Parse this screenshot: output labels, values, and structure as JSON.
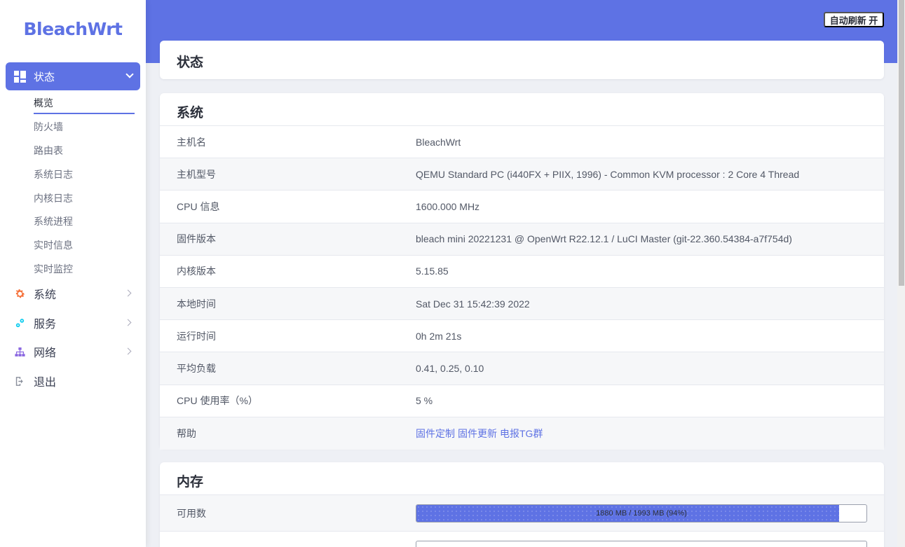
{
  "brand": "BleachWrt",
  "sidebar": {
    "active_menu": "状态",
    "sub_items": [
      "概览",
      "防火墙",
      "路由表",
      "系统日志",
      "内核日志",
      "系统进程",
      "实时信息",
      "实时监控"
    ],
    "menus": [
      {
        "label": "系统",
        "icon": "gear-icon",
        "color": "#f5713a"
      },
      {
        "label": "服务",
        "icon": "puzzle-icon",
        "color": "#11cdef"
      },
      {
        "label": "网络",
        "icon": "network-icon",
        "color": "#8965e0"
      },
      {
        "label": "退出",
        "icon": "logout-icon",
        "color": "#8a8f9c"
      }
    ]
  },
  "header": {
    "refresh_label": "自动刷新 开"
  },
  "page": {
    "title": "状态"
  },
  "system": {
    "title": "系统",
    "rows": [
      {
        "key": "主机名",
        "value": "BleachWrt"
      },
      {
        "key": "主机型号",
        "value": "QEMU Standard PC (i440FX + PIIX, 1996) - Common KVM processor : 2 Core 4 Thread"
      },
      {
        "key": "CPU 信息",
        "value": "1600.000 MHz"
      },
      {
        "key": "固件版本",
        "value": "bleach mini 20221231 @ OpenWrt R22.12.1 / LuCI Master (git-22.360.54384-a7f754d)"
      },
      {
        "key": "内核版本",
        "value": "5.15.85"
      },
      {
        "key": "本地时间",
        "value": "Sat Dec 31 15:42:39 2022"
      },
      {
        "key": "运行时间",
        "value": "0h 2m 21s"
      },
      {
        "key": "平均负载",
        "value": "0.41, 0.25, 0.10"
      },
      {
        "key": "CPU 使用率（%）",
        "value": "5 %"
      }
    ],
    "help_key": "帮助",
    "help_links": [
      "固件定制",
      "固件更新",
      "电报TG群"
    ]
  },
  "memory": {
    "title": "内存",
    "available_label": "可用数",
    "available_text": "1880 MB / 1993 MB (94%)",
    "available_percent": 94
  },
  "colors": {
    "accent": "#5e72e4"
  }
}
